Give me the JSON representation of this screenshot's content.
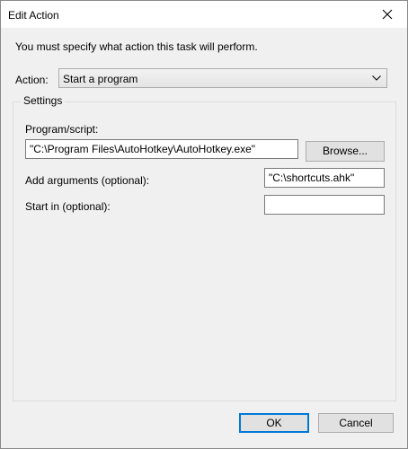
{
  "window": {
    "title": "Edit Action",
    "intro": "You must specify what action this task will perform."
  },
  "action": {
    "label": "Action:",
    "selected": "Start a program"
  },
  "settings": {
    "legend": "Settings",
    "program_label": "Program/script:",
    "program_value": "\"C:\\Program Files\\AutoHotkey\\AutoHotkey.exe\"",
    "browse_label": "Browse...",
    "args_label": "Add arguments (optional):",
    "args_value": "\"C:\\shortcuts.ahk\"",
    "start_label": "Start in (optional):",
    "start_value": ""
  },
  "buttons": {
    "ok": "OK",
    "cancel": "Cancel"
  },
  "icons": {
    "close": "close-icon",
    "dropdown": "chevron-down-icon"
  },
  "colors": {
    "dialog_bg": "#f0f0f0",
    "titlebar_bg": "#ffffff",
    "default_button_border": "#0078d7"
  }
}
